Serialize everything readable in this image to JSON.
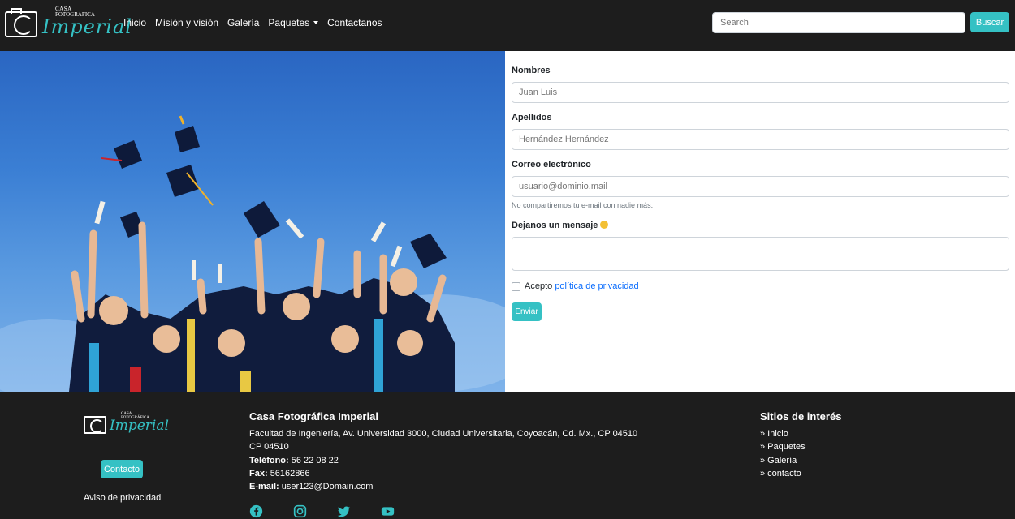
{
  "brand": {
    "line1": "CASA",
    "line2": "FOTOGRÁFICA",
    "name": "Imperial"
  },
  "nav": {
    "items": [
      {
        "label": "Inicio"
      },
      {
        "label": "Misión y visión"
      },
      {
        "label": "Galería"
      },
      {
        "label": "Paquetes"
      },
      {
        "label": "Contactanos"
      }
    ],
    "search_placeholder": "Search",
    "search_button": "Buscar"
  },
  "form": {
    "nombres_label": "Nombres",
    "nombres_placeholder": "Juan Luis",
    "apellidos_label": "Apellidos",
    "apellidos_placeholder": "Hernández Hernández",
    "email_label": "Correo electrónico",
    "email_placeholder": "usuario@dominio.mail",
    "email_help": "No compartiremos tu e-mail con nadie más.",
    "mensaje_label": "Dejanos un mensaje",
    "acepto_text": "Acepto",
    "privacy_link": "política de privacidad",
    "submit_label": "Enviar"
  },
  "footer": {
    "contacto_button": "Contacto",
    "aviso": "Aviso de privacidad",
    "company": "Casa Fotográfica Imperial",
    "address": "Facultad de Ingeniería, Av. Universidad 3000, Ciudad Universitaria, Coyoacán, Cd. Mx., CP 04510",
    "cp": "CP 04510",
    "phone_label": "Teléfono:",
    "phone": "56 22 08 22",
    "fax_label": "Fax:",
    "fax": "56162866",
    "email_label": "E-mail:",
    "email": "user123@Domain.com",
    "links_title": "Sitios de interés",
    "links": [
      "» Inicio",
      "» Paquetes",
      "» Galería",
      "» contacto"
    ],
    "social": [
      "facebook-icon",
      "instagram-icon",
      "twitter-icon",
      "youtube-icon"
    ]
  },
  "colors": {
    "accent": "#35c1c4",
    "dark": "#1d1d1d",
    "link": "#0d6efd"
  }
}
